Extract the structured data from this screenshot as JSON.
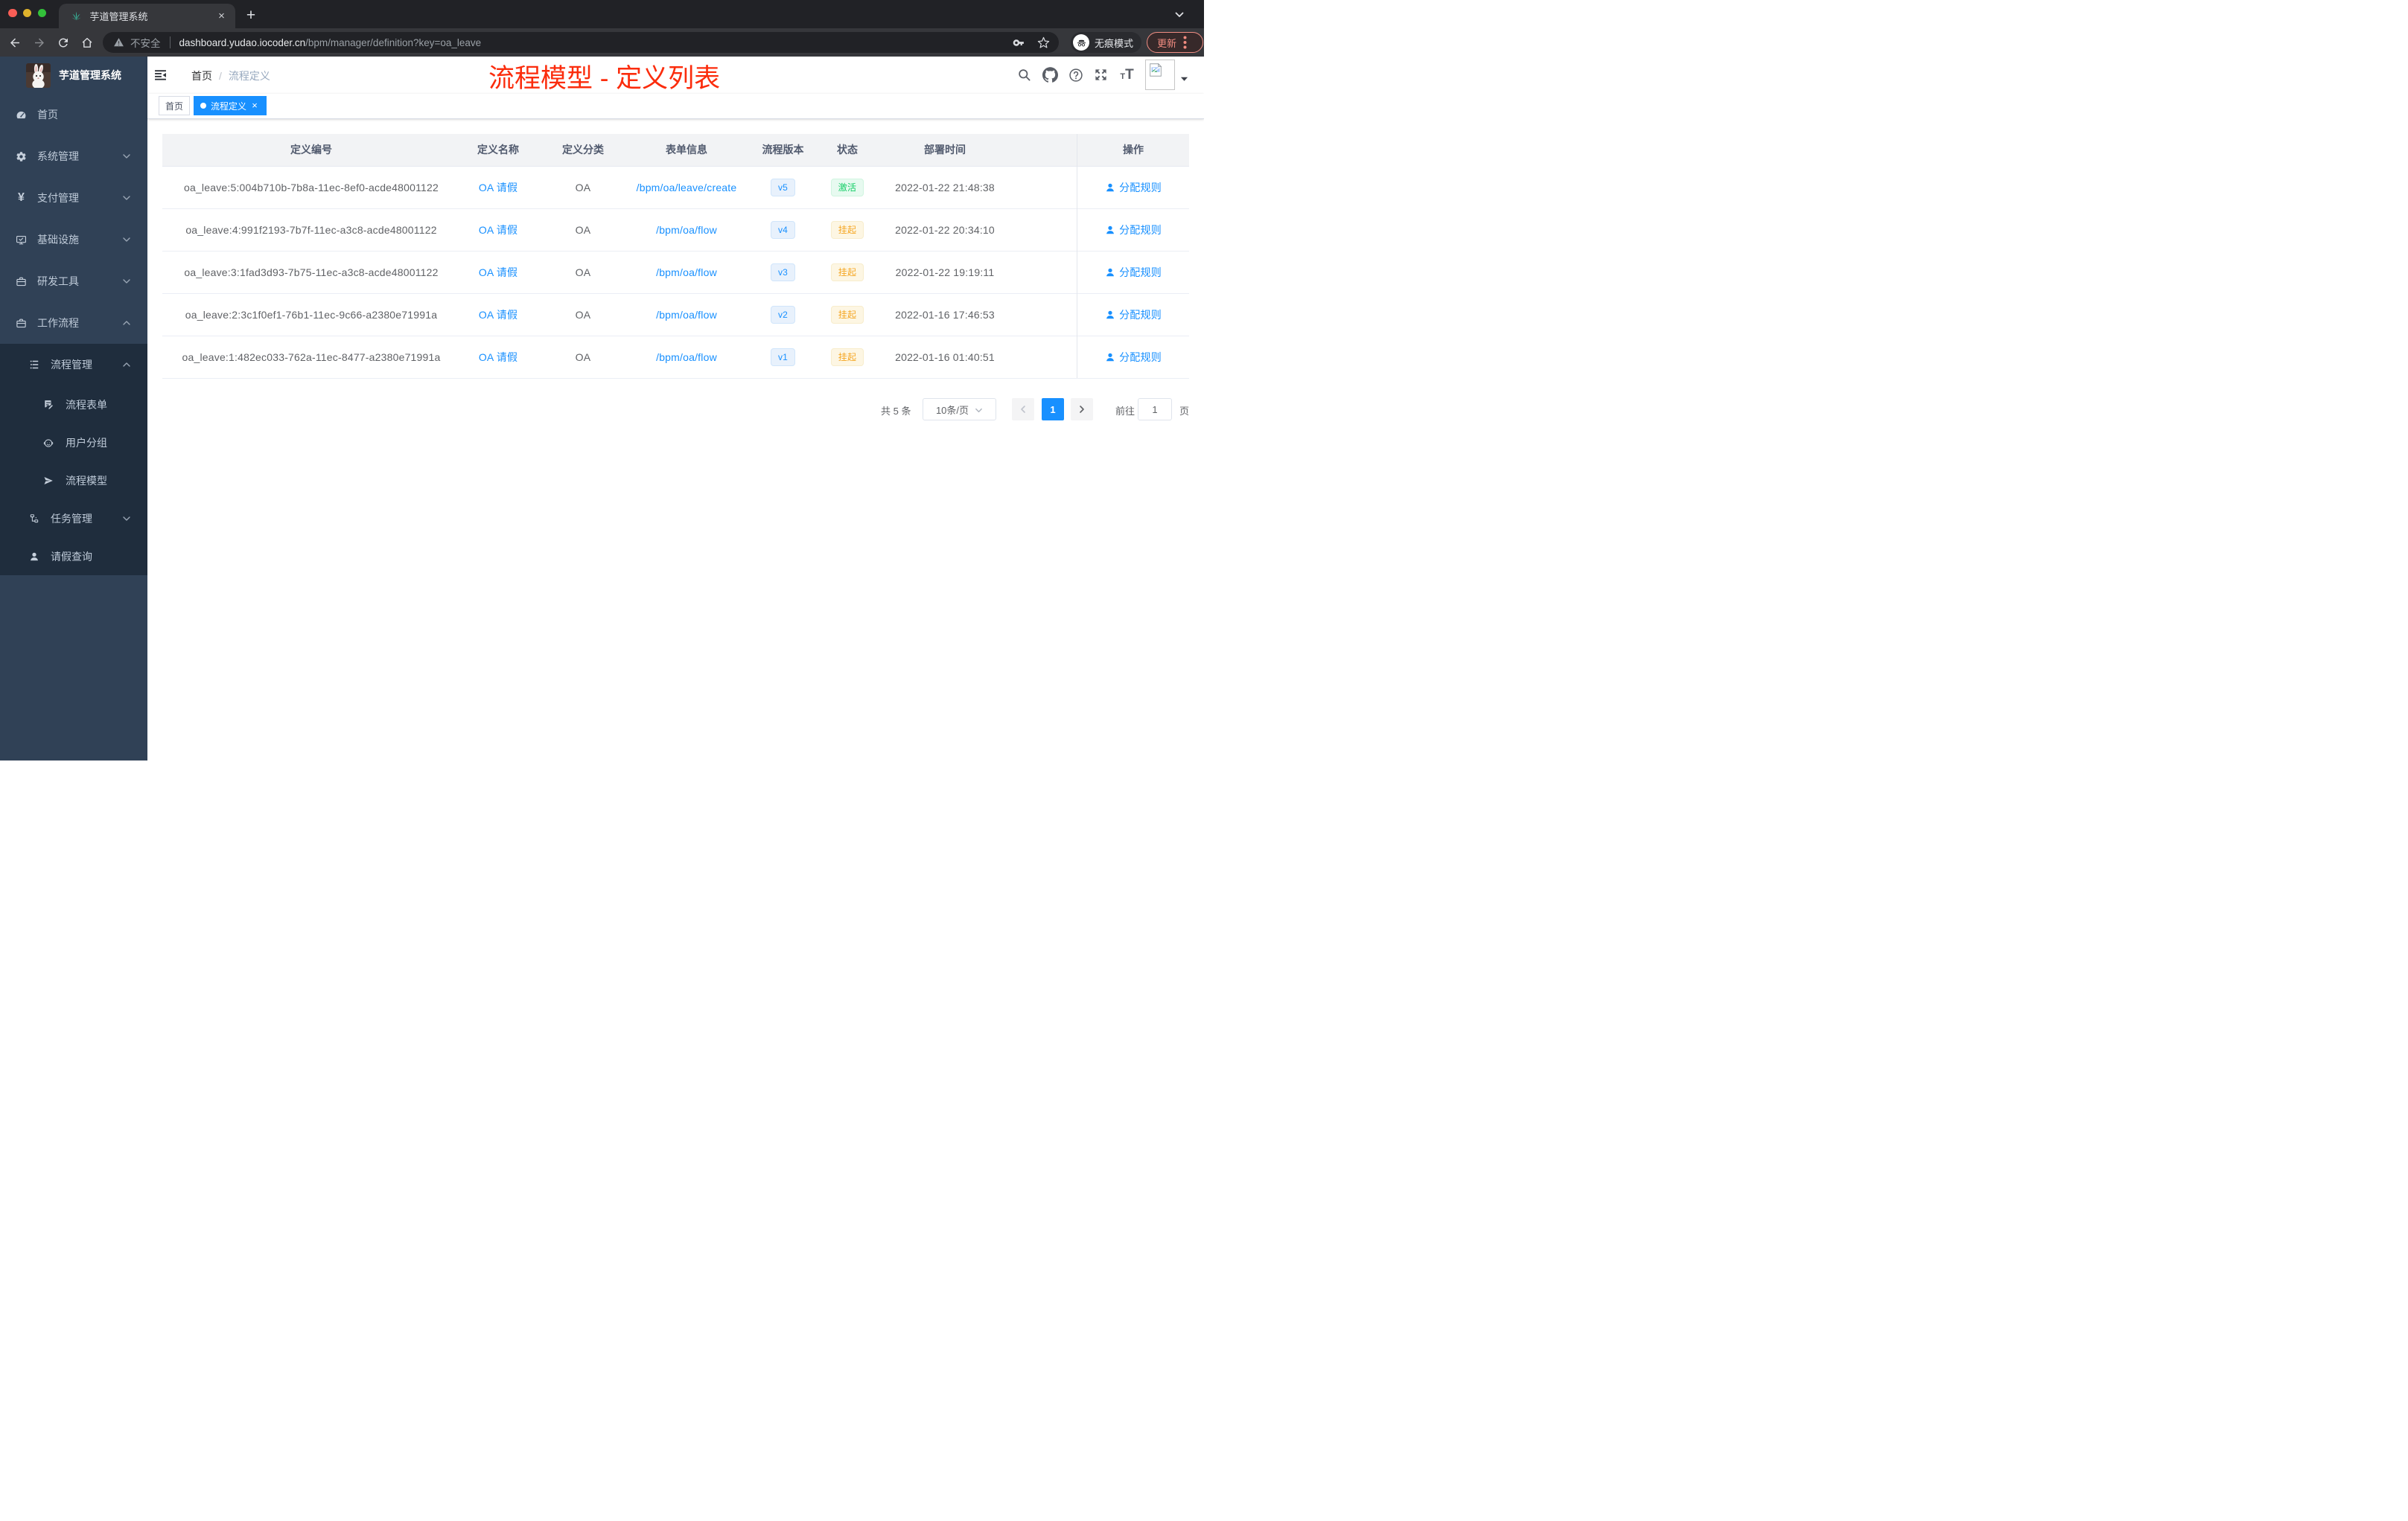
{
  "browser": {
    "tab": {
      "title": "芋道管理系统",
      "close_icon": "×"
    },
    "new_tab_icon": "+",
    "toolbar": {
      "security_label": "不安全",
      "url_host": "dashboard.yudao.iocoder.cn",
      "url_path": "/bpm/manager/definition?key=oa_leave",
      "incognito_label": "无痕模式",
      "update_label": "更新"
    }
  },
  "sidebar": {
    "logo_title": "芋道管理系统",
    "items": [
      {
        "label": "首页"
      },
      {
        "label": "系统管理"
      },
      {
        "label": "支付管理"
      },
      {
        "label": "基础设施"
      },
      {
        "label": "研发工具"
      },
      {
        "label": "工作流程"
      }
    ],
    "submenu": {
      "label": "流程管理"
    },
    "submenu_children": [
      {
        "label": "流程表单"
      },
      {
        "label": "用户分组"
      },
      {
        "label": "流程模型"
      }
    ],
    "submenu_siblings": [
      {
        "label": "任务管理"
      },
      {
        "label": "请假查询"
      }
    ]
  },
  "header": {
    "breadcrumb": {
      "home": "首页",
      "separator": "/",
      "current": "流程定义"
    },
    "annotation": {
      "text": "流程模型 - 定义列表",
      "color": "#fb2c0c"
    }
  },
  "tags": {
    "home": "首页",
    "active": "流程定义",
    "close_icon": "×"
  },
  "table": {
    "columns": {
      "id": "定义编号",
      "name": "定义名称",
      "category": "定义分类",
      "form": "表单信息",
      "version": "流程版本",
      "status": "状态",
      "deploy_time": "部署时间",
      "action": "操作"
    },
    "rows": [
      {
        "id": "oa_leave:5:004b710b-7b8a-11ec-8ef0-acde48001122",
        "name": "OA 请假",
        "category": "OA",
        "form": "/bpm/oa/leave/create",
        "version": "v5",
        "status": "激活",
        "deploy_time": "2022-01-22 21:48:38",
        "action": "分配规则"
      },
      {
        "id": "oa_leave:4:991f2193-7b7f-11ec-a3c8-acde48001122",
        "name": "OA 请假",
        "category": "OA",
        "form": "/bpm/oa/flow",
        "version": "v4",
        "status": "挂起",
        "deploy_time": "2022-01-22 20:34:10",
        "action": "分配规则"
      },
      {
        "id": "oa_leave:3:1fad3d93-7b75-11ec-a3c8-acde48001122",
        "name": "OA 请假",
        "category": "OA",
        "form": "/bpm/oa/flow",
        "version": "v3",
        "status": "挂起",
        "deploy_time": "2022-01-22 19:19:11",
        "action": "分配规则"
      },
      {
        "id": "oa_leave:2:3c1f0ef1-76b1-11ec-9c66-a2380e71991a",
        "name": "OA 请假",
        "category": "OA",
        "form": "/bpm/oa/flow",
        "version": "v2",
        "status": "挂起",
        "deploy_time": "2022-01-16 17:46:53",
        "action": "分配规则"
      },
      {
        "id": "oa_leave:1:482ec033-762a-11ec-8477-a2380e71991a",
        "name": "OA 请假",
        "category": "OA",
        "form": "/bpm/oa/flow",
        "version": "v1",
        "status": "挂起",
        "deploy_time": "2022-01-16 01:40:51",
        "action": "分配规则"
      }
    ]
  },
  "pagination": {
    "total": "共 5 条",
    "page_size": "10条/页",
    "current_page": "1",
    "goto_label": "前往",
    "goto_page": "1",
    "page_suffix": "页"
  },
  "colors": {
    "accent_blue": "#1890ff",
    "link_blue": "#1890ff",
    "status_active_green": "#13ce66",
    "status_suspend_orange": "#f5a623",
    "sidebar_bg": "#304156",
    "sidebar_submenu_bg": "#1f2d3d",
    "annotation_red": "#fb2c0c"
  }
}
